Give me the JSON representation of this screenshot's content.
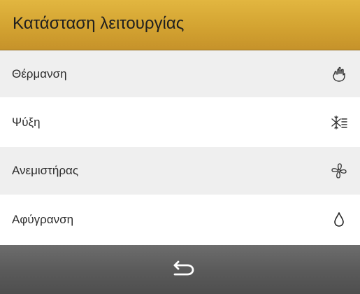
{
  "header": {
    "title": "Κατάσταση λειτουργίας"
  },
  "modes": [
    {
      "label": "Θέρμανση",
      "icon": "heating-flame-icon"
    },
    {
      "label": "Ψύξη",
      "icon": "cooling-snowflake-icon"
    },
    {
      "label": "Ανεμιστήρας",
      "icon": "fan-icon"
    },
    {
      "label": "Αφύγρανση",
      "icon": "dehumidify-drop-icon"
    }
  ],
  "footer": {
    "back_icon": "back-arrow-icon"
  },
  "colors": {
    "header": "#d4a332",
    "row_shaded": "#efefef",
    "row_plain": "#ffffff",
    "footer": "#5b5b5b"
  }
}
